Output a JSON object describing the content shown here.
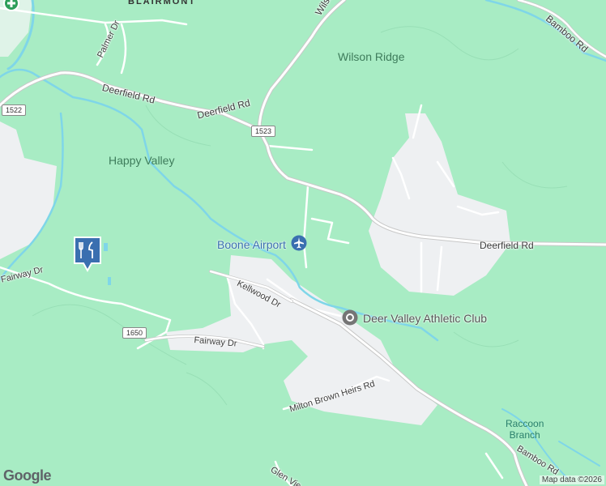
{
  "map": {
    "place_labels": {
      "blairmont": "BLAIRMONT",
      "wilson_ridge": "Wilson Ridge",
      "happy_valley": "Happy Valley",
      "raccoon_branch": "Raccoon\nBranch"
    },
    "roads": {
      "wilson_rd": "Wilson Rd",
      "bamboo_rd_top": "Bamboo Rd",
      "palmer_dr": "Palmer Dr",
      "deerfield_rd_1": "Deerfield Rd",
      "deerfield_rd_2": "Deerfield Rd",
      "deerfield_rd_3": "Deerfield Rd",
      "fairway_dr_left": "Fairway Dr",
      "kellwood_dr": "Kellwood Dr",
      "fairway_dr": "Fairway Dr",
      "milton_brown": "Milton Brown Heirs Rd",
      "bamboo_rd_bottom": "Bamboo Rd",
      "glen_view": "Glen Vie"
    },
    "shields": {
      "s1522": "1522",
      "s1523": "1523",
      "s1650": "1650"
    },
    "pois": {
      "airport": "Boone Airport",
      "athletic_club": "Deer Valley Athletic Club"
    },
    "icons": {
      "airport": "airport-icon",
      "athletic_club": "place-icon",
      "restaurant": "restaurant-icon",
      "medical": "medical-icon"
    },
    "attribution": "Map data ©2026",
    "logo": "Google",
    "colors": {
      "terrain": "#a8ecc4",
      "urban": "#eef0f2",
      "water": "#7fd6e8",
      "road": "#ffffff",
      "road_casing": "#c8c8c8",
      "poi_blue": "#3a6fb0"
    }
  }
}
